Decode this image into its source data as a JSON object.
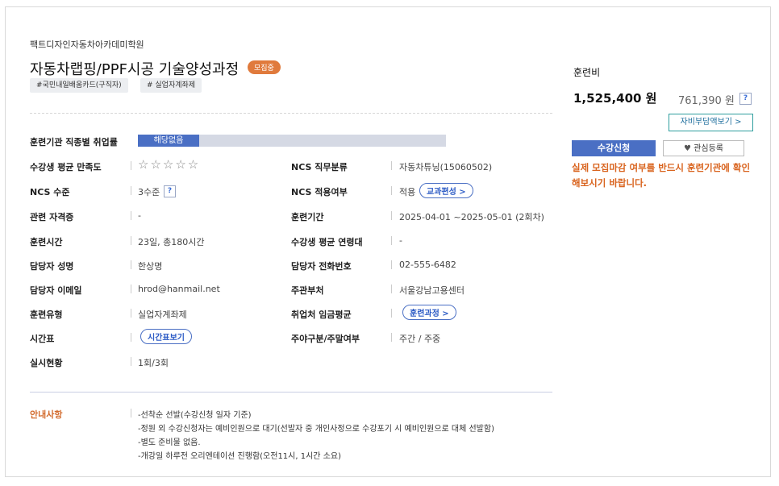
{
  "institution": "팩트디자인자동차아카데미학원",
  "course_title": "자동차랩핑/PPF시공 기술양성과정",
  "status_badge": "모집중",
  "tags": [
    "#국민내일배움카드(구직자)",
    "# 실업자계좌제"
  ],
  "employment": {
    "label": "훈련기관 직종별 취업률",
    "value": "해당없음"
  },
  "rows": {
    "satisfaction_label": "수강생 평균 만족도",
    "stars": "☆☆☆☆☆",
    "ncs_field_label": "NCS 직무분류",
    "ncs_field_value": "자동차튜닝(15060502)",
    "ncs_level_label": "NCS 수준",
    "ncs_level_value": "3수준",
    "help_mark": "?",
    "ncs_apply_label": "NCS 적용여부",
    "ncs_apply_value": "적용",
    "curriculum_btn": "교과편성 >",
    "cert_label": "관련 자격증",
    "cert_value": "-",
    "period_label": "훈련기간",
    "period_value": "2025-04-01 ~2025-05-01 (2회차)",
    "hours_label": "훈련시간",
    "hours_value": "23일, 총180시간",
    "age_label": "수강생 평균 연령대",
    "age_value": "-",
    "manager_label": "담당자 성명",
    "manager_value": "한상명",
    "phone_label": "담당자 전화번호",
    "phone_value": "02-555-6482",
    "email_label": "담당자 이메일",
    "email_value": "hrod@hanmail.net",
    "agency_label": "주관부처",
    "agency_value": "서울강남고용센터",
    "type_label": "훈련유형",
    "type_value": "실업자계좌제",
    "wage_label": "취업처 임금평균",
    "wage_btn": "훈련과정 >",
    "timetable_label": "시간표",
    "timetable_btn": "시간표보기",
    "daynight_label": "주야구분/주말여부",
    "daynight_value": "주간 / 주중",
    "status_label": "실시현황",
    "status_value": "1회/3회"
  },
  "notice": {
    "label": "안내사항",
    "lines": [
      "-선착순 선발(수강신청 일자 기준)",
      "-정원 외 수강신청자는 예비인원으로 대기(선발자 중 개인사정으로 수강포기 시 예비인원으로 대체 선발함)",
      "-별도 준비물 없음.",
      "-개강일 하루전 오리엔테이션 진행함(오전11시, 1시간 소요)"
    ]
  },
  "fee": {
    "label": "훈련비",
    "total": "1,525,400 원",
    "self_pay": "761,390 원",
    "help_mark": "?",
    "self_pay_btn": "자비부담액보기 >"
  },
  "actions": {
    "apply": "수강신청",
    "favorite": "관심등록",
    "warning": "실제 모집마감 여부를 반드시 훈련기관에 확인해보시기 바랍니다."
  },
  "colors": {
    "accent": "#4a6fc4",
    "orange": "#e07a3c",
    "warning": "#d9641f"
  }
}
